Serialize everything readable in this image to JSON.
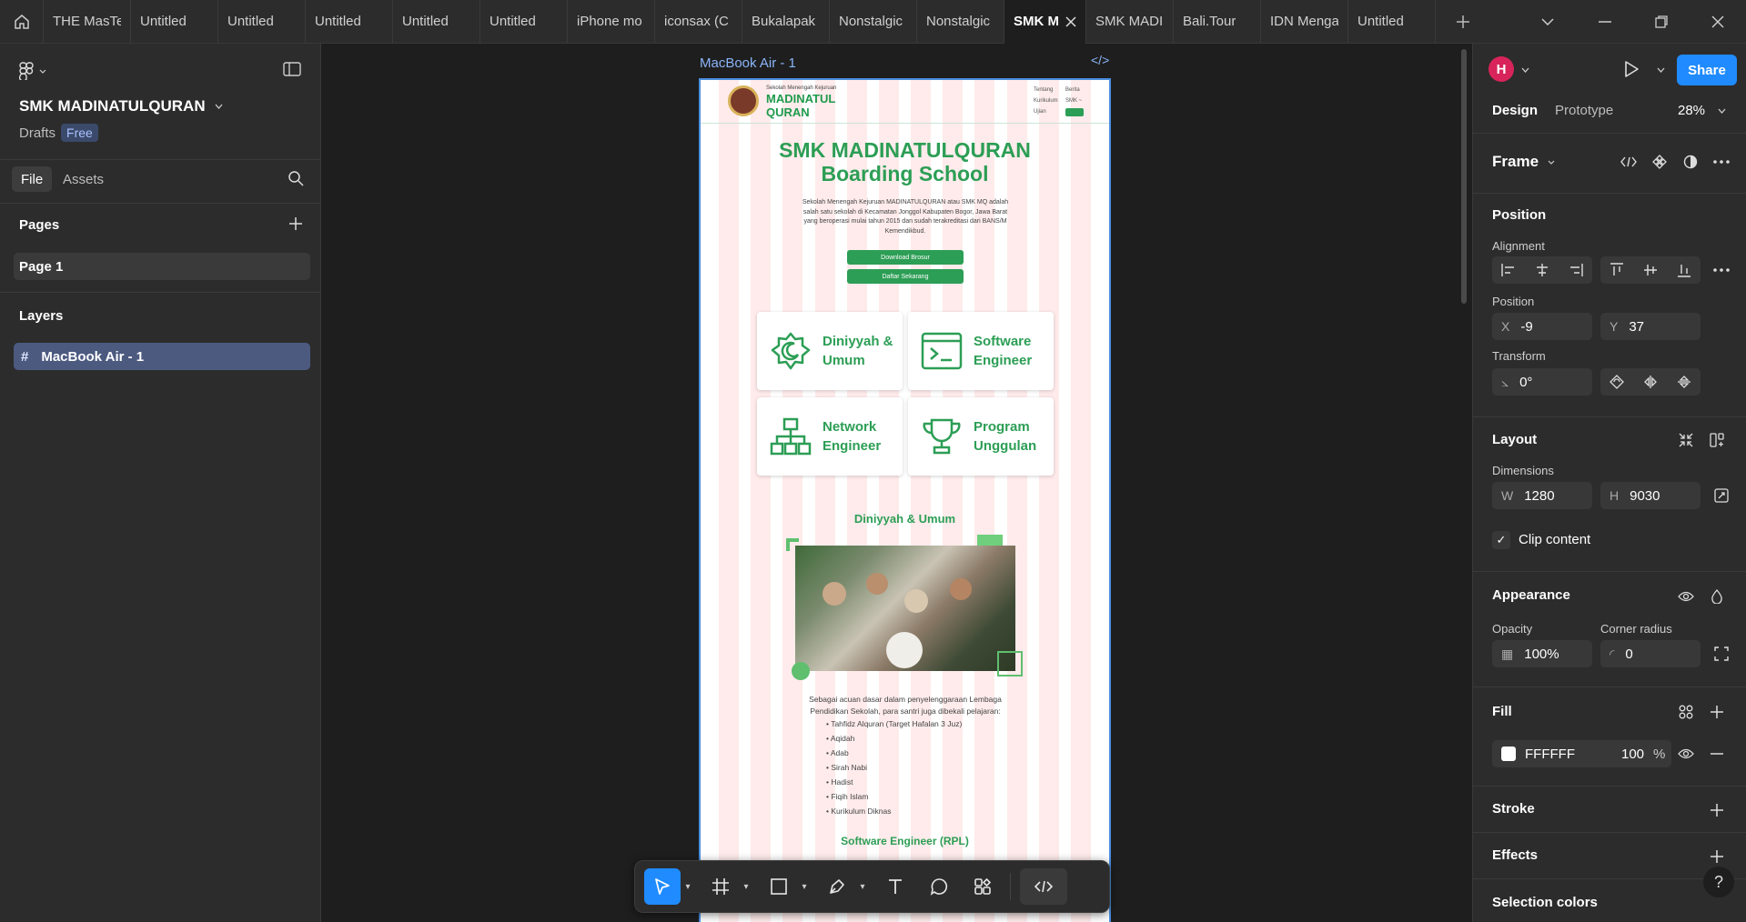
{
  "tabs": [
    "THE MasTe",
    "Untitled",
    "Untitled",
    "Untitled",
    "Untitled",
    "Untitled",
    "iPhone mo",
    "iconsax (C",
    "Bukalapak",
    "Nonstalgic",
    "Nonstalgic",
    "SMK M",
    "SMK MADI",
    "Bali.Tour",
    "IDN Menga",
    "Untitled"
  ],
  "file": {
    "project_name": "SMK MADINATULQURAN",
    "drafts_label": "Drafts",
    "plan_badge": "Free",
    "tab_file": "File",
    "tab_assets": "Assets",
    "pages_title": "Pages",
    "page_item": "Page 1",
    "layers_title": "Layers",
    "layer_item": "MacBook Air - 1"
  },
  "canvas": {
    "frame_label": "MacBook Air - 1",
    "frame_code": "</>",
    "site": {
      "logo_small": "Sekolah Menengah Kejuruan",
      "logo_line1": "MADINATUL",
      "logo_line2": "QURAN",
      "nav_1": "Tentang",
      "nav_2": "Berita",
      "nav_3": "Kurikulum",
      "nav_4": "SMK ~",
      "nav_5": "Ujian",
      "hero_line1": "SMK MADINATULQURAN",
      "hero_line2": "Boarding School",
      "hero_desc": "Sekolah Menengah Kejuruan MADINATULQURAN atau SMK MQ adalah salah satu sekolah di Kecamatan Jonggol Kabupaten Bogor, Jawa Barat yang beroperasi mulai tahun 2015 dan sudah terakreditasi dari BANS/M Kemendikbud.",
      "btn_download": "Download Brosur",
      "btn_daftar": "Daftar Sekarang",
      "card1_l1": "Diniyyah &",
      "card1_l2": "Umum",
      "card2_l1": "Software",
      "card2_l2": "Engineer",
      "card3_l1": "Network",
      "card3_l2": "Engineer",
      "card4_l1": "Program",
      "card4_l2": "Unggulan",
      "section1_title": "Diniyyah & Umum",
      "section1_para": "Sebagai acuan dasar dalam penyelenggaraan Lembaga Pendidikan Sekolah, para santri juga dibekali pelajaran:",
      "list": [
        "Tahfidz Alquran (Target Hafalan 3 Juz)",
        "Aqidah",
        "Adab",
        "Sirah Nabi",
        "Hadist",
        "Fiqih Islam",
        "Kurikulum Diknas"
      ],
      "section2_title": "Software Engineer (RPL)"
    }
  },
  "design": {
    "avatar_letter": "H",
    "share_label": "Share",
    "tab_design": "Design",
    "tab_prototype": "Prototype",
    "zoom": "28%",
    "frame_label": "Frame",
    "position_title": "Position",
    "alignment_label": "Alignment",
    "position_label": "Position",
    "x_key": "X",
    "x_value": "-9",
    "y_key": "Y",
    "y_value": "37",
    "transform_label": "Transform",
    "rotation_value": "0°",
    "layout_title": "Layout",
    "dimensions_label": "Dimensions",
    "w_key": "W",
    "w_value": "1280",
    "h_key": "H",
    "h_value": "9030",
    "clip_content": "Clip content",
    "appearance_title": "Appearance",
    "opacity_label": "Opacity",
    "opacity_value": "100%",
    "corner_label": "Corner radius",
    "corner_value": "0",
    "fill_title": "Fill",
    "fill_hex": "FFFFFF",
    "fill_opacity": "100",
    "fill_pct": "%",
    "stroke_title": "Stroke",
    "effects_title": "Effects",
    "selection_colors_title": "Selection colors",
    "help_label": "?"
  },
  "colors": {
    "accent": "#1f8bff",
    "brand_green": "#2c9e55",
    "layer_selected": "#4c5a80",
    "avatar": "#d8245a"
  }
}
